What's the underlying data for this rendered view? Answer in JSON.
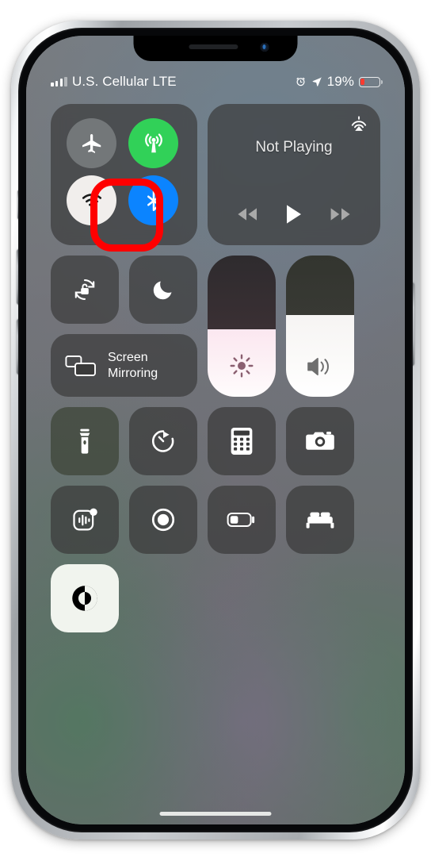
{
  "device": {
    "model": "iphone",
    "frame_color": "silver"
  },
  "status_bar": {
    "carrier": "U.S. Cellular LTE",
    "signal_bars_filled": 3,
    "signal_bars_total": 4,
    "alarm_icon": "alarm-clock-icon",
    "location_icon": "location-arrow-icon",
    "battery_percent": "19%",
    "battery_level": 19,
    "battery_color": "#fb3b30"
  },
  "control_center": {
    "connectivity": {
      "buttons": [
        {
          "name": "airplane-mode",
          "icon": "airplane-icon",
          "state": "off",
          "color": "#7d8082"
        },
        {
          "name": "cellular-data",
          "icon": "cellular-antenna-icon",
          "state": "on",
          "color": "#31d158"
        },
        {
          "name": "wifi",
          "icon": "wifi-icon",
          "state": "off",
          "color": "#f1eeec",
          "highlighted": true
        },
        {
          "name": "bluetooth",
          "icon": "bluetooth-icon",
          "state": "on",
          "color": "#0b84ff"
        }
      ]
    },
    "now_playing": {
      "title": "Not Playing",
      "airplay_icon": "airplay-icon",
      "controls": [
        {
          "name": "rewind",
          "icon": "rewind-icon"
        },
        {
          "name": "play",
          "icon": "play-icon"
        },
        {
          "name": "fast-forward",
          "icon": "fast-forward-icon"
        }
      ]
    },
    "toggles": [
      {
        "name": "rotation-lock",
        "icon": "rotation-lock-icon",
        "state": "off"
      },
      {
        "name": "do-not-disturb",
        "icon": "moon-icon",
        "state": "off"
      }
    ],
    "screen_mirroring": {
      "label_line1": "Screen",
      "label_line2": "Mirroring",
      "icon": "screen-mirroring-icon"
    },
    "sliders": [
      {
        "name": "brightness",
        "icon": "brightness-sun-icon",
        "value": 48,
        "tint": "#fbe7f0"
      },
      {
        "name": "volume",
        "icon": "speaker-waves-icon",
        "value": 58,
        "tint": "#f6f4f3"
      }
    ],
    "tiles_row_1": [
      {
        "name": "flashlight",
        "icon": "flashlight-icon",
        "state": "off"
      },
      {
        "name": "timer",
        "icon": "timer-icon",
        "state": "off"
      },
      {
        "name": "calculator",
        "icon": "calculator-icon",
        "state": "off"
      },
      {
        "name": "camera",
        "icon": "camera-icon",
        "state": "off"
      }
    ],
    "tiles_row_2": [
      {
        "name": "sound-recognition",
        "icon": "sound-recognition-icon",
        "state": "off",
        "badge": true
      },
      {
        "name": "screen-recording",
        "icon": "screen-record-icon",
        "state": "off"
      },
      {
        "name": "low-power-mode",
        "icon": "low-battery-icon",
        "state": "off"
      },
      {
        "name": "sleep-mode",
        "icon": "bed-icon",
        "state": "off"
      }
    ],
    "tiles_row_3": [
      {
        "name": "dark-mode",
        "icon": "dark-mode-icon",
        "state": "on"
      }
    ]
  },
  "annotation": {
    "type": "highlight-ring",
    "color": "#ff0000",
    "target": "wifi"
  }
}
